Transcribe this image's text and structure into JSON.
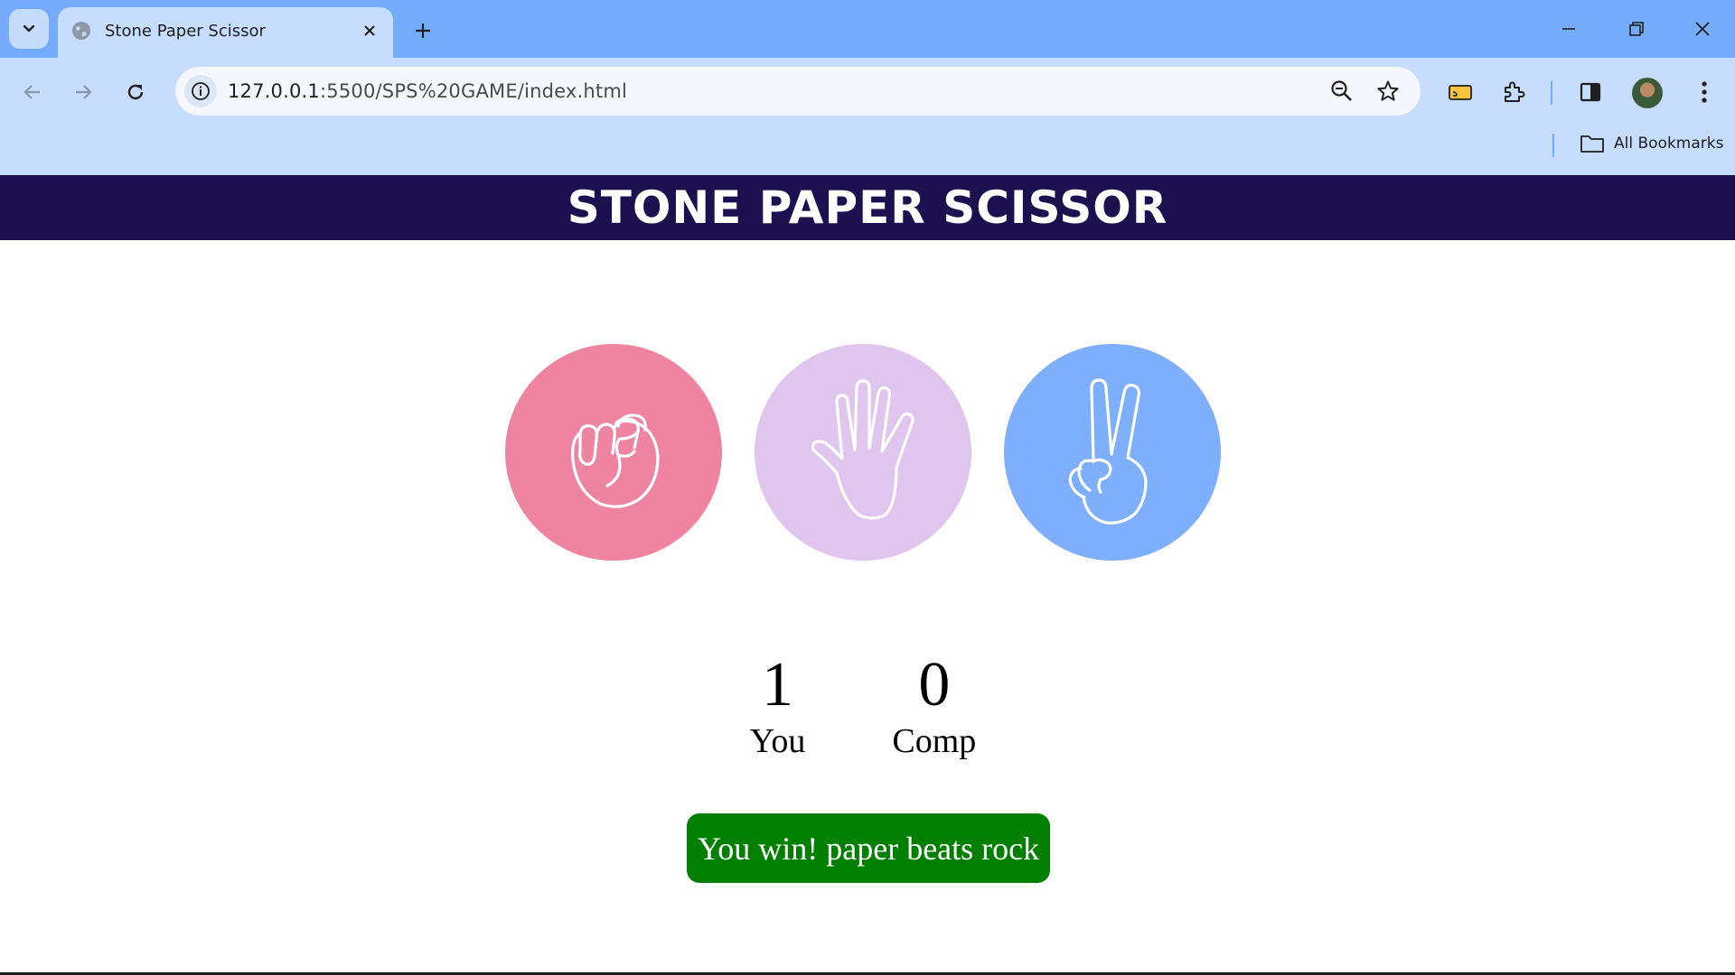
{
  "browser": {
    "tab_title": "Stone Paper Scissor",
    "url_host": "127.0.0.1",
    "url_rest": ":5500/SPS%20GAME/index.html",
    "bookmarks_label": "All Bookmarks"
  },
  "page": {
    "title": "STONE PAPER SCISSOR",
    "choices": [
      {
        "id": "rock",
        "color": "#ef84a1",
        "icon": "fist-icon"
      },
      {
        "id": "paper",
        "color": "#e0c6ee",
        "icon": "open-hand-icon"
      },
      {
        "id": "scissors",
        "color": "#7eaffc",
        "icon": "peace-hand-icon"
      }
    ],
    "score": {
      "user_score": "1",
      "user_label": "You",
      "comp_score": "0",
      "comp_label": "Comp"
    },
    "message": {
      "text": "You win! paper beats rock",
      "color": "#017f01"
    }
  },
  "colors": {
    "header_bg": "#1c1050",
    "tabbar_bg": "#74acfb",
    "toolbar_bg": "#c6ddfe"
  }
}
